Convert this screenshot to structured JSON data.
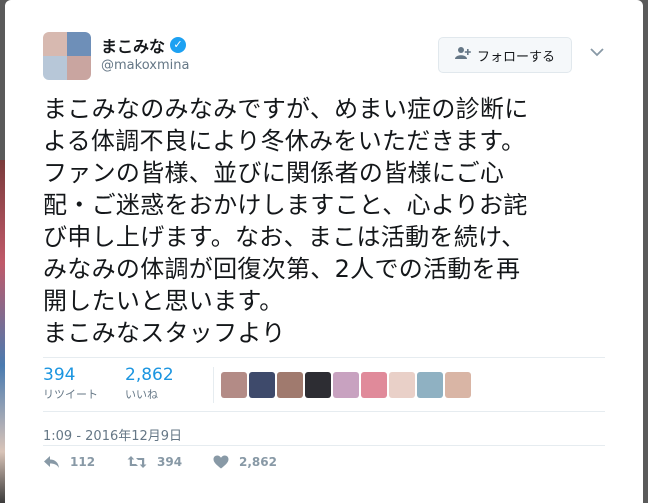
{
  "user": {
    "name": "まこみな",
    "handle": "@makoxmina",
    "avatar_colors": [
      "#d7b9b0",
      "#6e8fb8",
      "#b7c7d8",
      "#c9a5a0"
    ]
  },
  "follow_button": {
    "label": "フォローする",
    "icon": "add-user-icon"
  },
  "tweet": {
    "text": "まこみなのみなみですが、めまい症の診断に\nよる体調不良により冬休みをいただきます。\nファンの皆様、並びに関係者の皆様にご心\n配・ご迷惑をおかけしますこと、心よりお詫\nび申し上げます。なお、まこは活動を続け、\nみなみの体調が回復次第、2人での活動を再\n開したいと思います。\nまこみなスタッフより"
  },
  "stats": {
    "retweets": {
      "count": "394",
      "label": "リツイート"
    },
    "likes": {
      "count": "2,862",
      "label": "いいね"
    }
  },
  "liker_colors": [
    "#b38b86",
    "#3e4a6b",
    "#a07a6e",
    "#2d2d33",
    "#c8a2c0",
    "#e08a9a",
    "#e9d0c8",
    "#8fb1c2",
    "#d9b5a5"
  ],
  "timestamp": "1:09 - 2016年12月9日",
  "actions": {
    "reply_count": "112",
    "retweet_count": "394",
    "like_count": "2,862"
  },
  "colors": {
    "accent": "#1da1f2",
    "link": "#1b95e0",
    "muted": "#657786"
  }
}
